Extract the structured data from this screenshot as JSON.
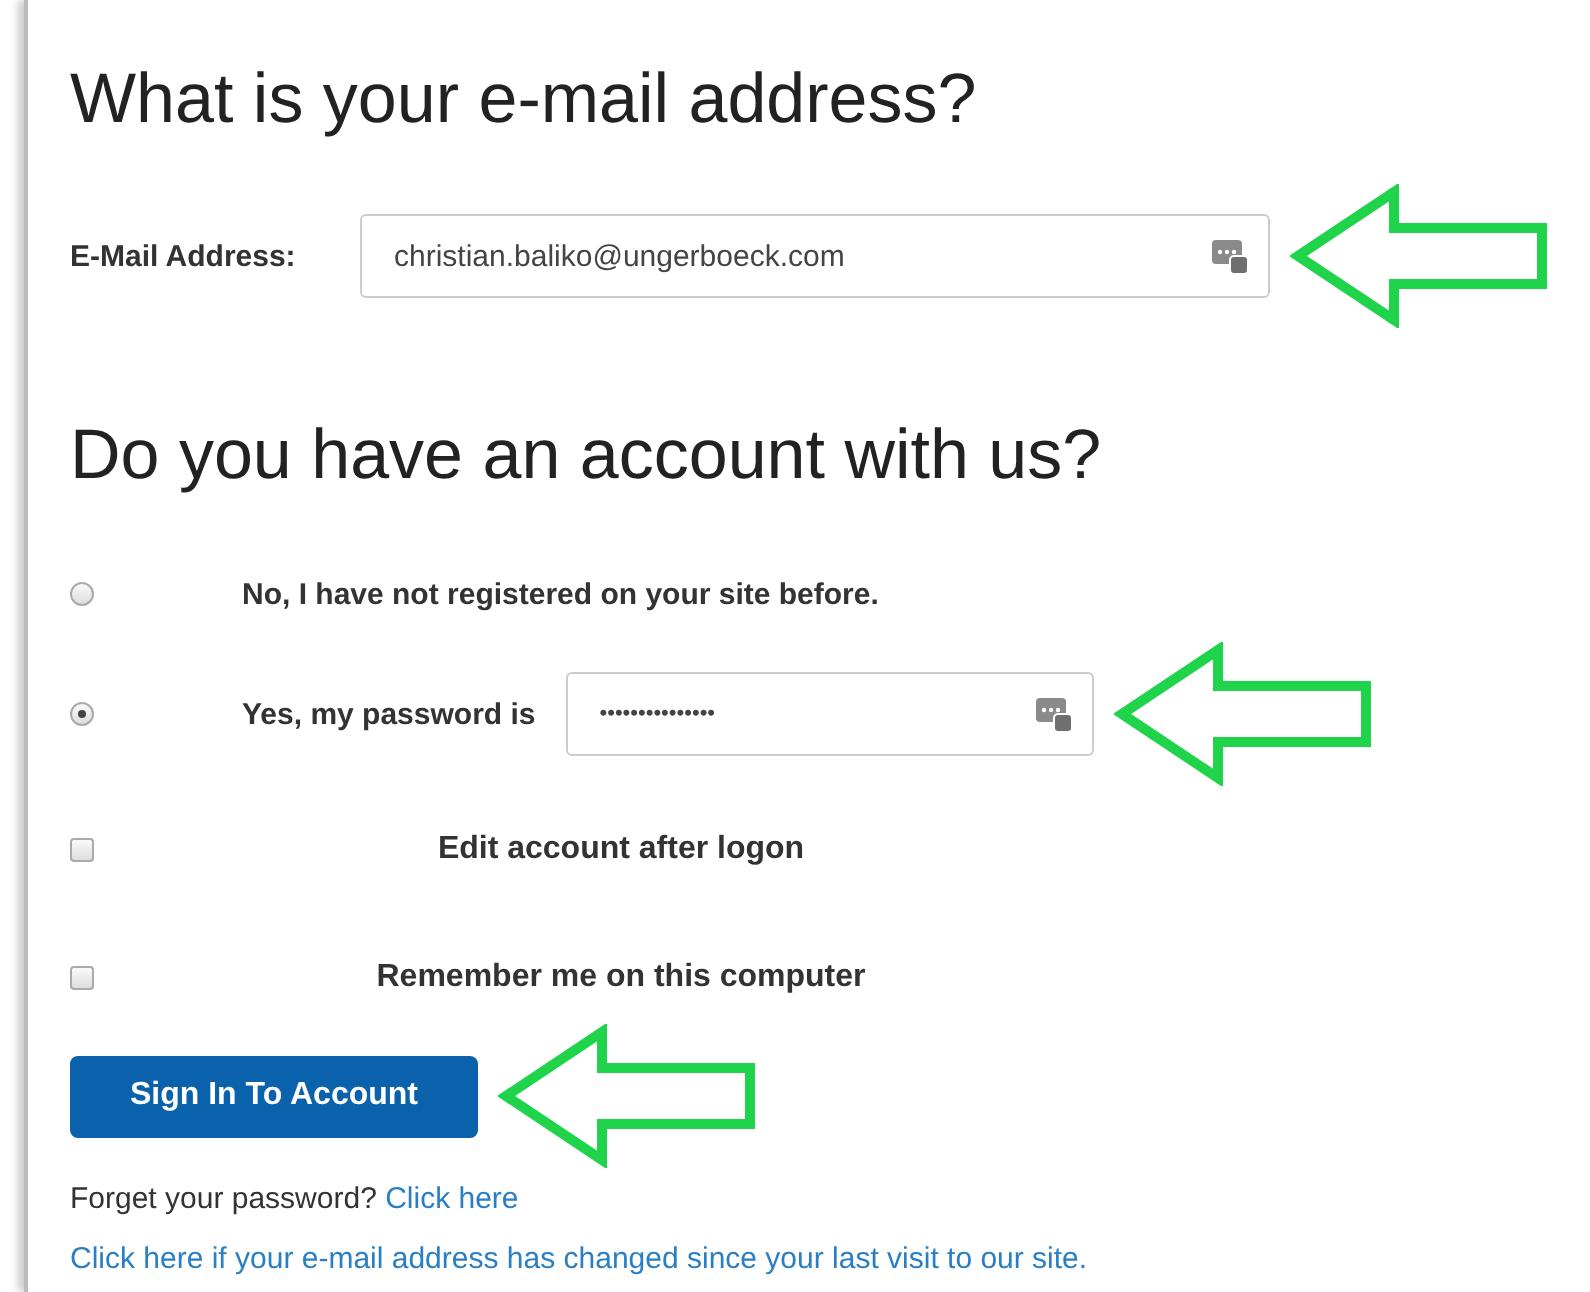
{
  "heading_email": "What is your e-mail address?",
  "email": {
    "label": "E-Mail Address:",
    "value": "christian.baliko@ungerboeck.com"
  },
  "heading_account": "Do you have an account with us?",
  "options": [
    {
      "kind": "radio",
      "label": "No, I have not registered on your site before.",
      "selected": false
    },
    {
      "kind": "radio",
      "label": "Yes, my password is",
      "selected": true,
      "field_value": "•••••••••••••••"
    },
    {
      "kind": "checkbox",
      "label": "Edit account after logon",
      "checked": false
    },
    {
      "kind": "checkbox",
      "label": "Remember me on this computer",
      "checked": false
    }
  ],
  "button": "Sign In To Account",
  "forgot": {
    "text": "Forget your password?",
    "link": "Click here"
  },
  "changed_link": "Click here if your e-mail address has changed since your last visit to our site."
}
